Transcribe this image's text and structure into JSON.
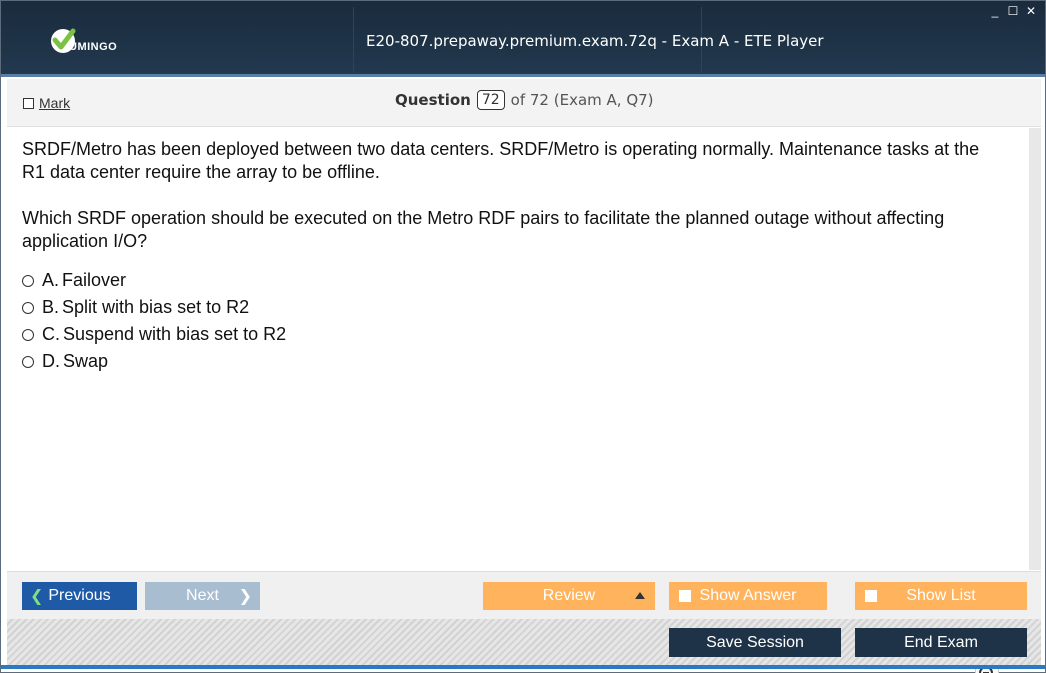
{
  "window": {
    "brand": "UMINGO",
    "title": "E20-807.prepaway.premium.exam.72q - Exam A - ETE Player",
    "controls": {
      "minimize": "_",
      "maximize": "☐",
      "close": "✕"
    }
  },
  "question_bar": {
    "mark_label": "Mark",
    "question_label": "Question",
    "current": "72",
    "of_text": "of 72 (Exam A, Q7)"
  },
  "question": {
    "paragraphs": [
      "SRDF/Metro has been deployed between two data centers. SRDF/Metro is operating normally. Maintenance tasks at the R1 data center require the array to be offline.",
      "Which SRDF operation should be executed on the Metro RDF pairs to facilitate the planned outage without affecting application I/O?"
    ],
    "answers": [
      {
        "letter": "A.",
        "text": "Failover"
      },
      {
        "letter": "B.",
        "text": "Split with bias set to R2"
      },
      {
        "letter": "C.",
        "text": "Suspend with bias set to R2"
      },
      {
        "letter": "D.",
        "text": "Swap"
      }
    ]
  },
  "zoom": {
    "icons": [
      "magnifier-icon",
      "zoom-in-icon",
      "zoom-out-icon"
    ]
  },
  "nav": {
    "previous": "Previous",
    "next": "Next",
    "review": "Review",
    "show_answer": "Show Answer",
    "show_list": "Show List",
    "save_session": "Save Session",
    "end_exam": "End Exam"
  },
  "colors": {
    "title_bg": "#1f3347",
    "accent_blue": "#1f5aa6",
    "orange": "#ffb35c",
    "dark_button": "#1e3248",
    "logo_green": "#7cc242"
  }
}
